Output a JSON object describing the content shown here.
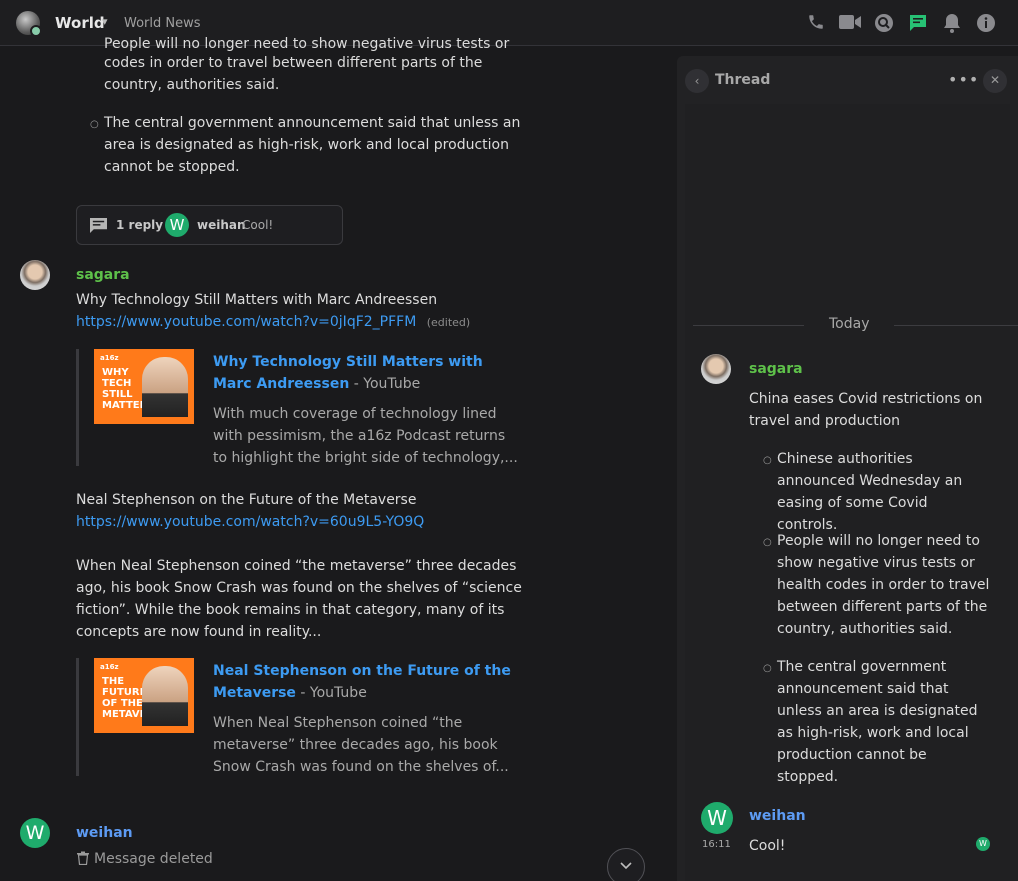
{
  "header": {
    "channel_name": "World",
    "topic": "World News"
  },
  "timeline": {
    "prev_message": {
      "partial_line": "People will no longer need to show negative virus tests or health",
      "bullet_2": "codes in order to travel between different parts of the country, authorities said.",
      "bullet_3": "The central government announcement said that unless an area is designated as high-risk, work and local production cannot be stopped."
    },
    "thread_summary": {
      "reply_count": "1 reply",
      "last_author": "weihan",
      "last_author_initial": "W",
      "last_text": "Cool!"
    },
    "sagara_message": {
      "author": "sagara",
      "line1": "Why Technology Still Matters with Marc Andreessen",
      "link1": "https://www.youtube.com/watch?v=0jIqF2_PFFM",
      "edited": "(edited)",
      "preview1": {
        "title": "Why Technology Still Matters with Marc Andreessen",
        "source": " - YouTube",
        "desc": "With much coverage of technology lined with pessimism, the a16z Podcast returns to highlight the bright side of technology,...",
        "thumb_logo": "a16z",
        "thumb_text": "WHY TECH STILL MATTERS"
      },
      "line2": "Neal Stephenson on the Future of the Metaverse",
      "link2": "https://www.youtube.com/watch?v=60u9L5-YO9Q",
      "para": "When Neal Stephenson coined “the metaverse” three decades ago, his book Snow Crash was found on the shelves of “science fiction”. While the book remains in that category, many of its concepts are now found in reality...",
      "preview2": {
        "title": "Neal Stephenson on the Future of the Metaverse",
        "source": " - YouTube",
        "desc": "When Neal Stephenson coined “the metaverse” three decades ago, his book Snow Crash was found on the shelves of...",
        "thumb_logo": "a16z",
        "thumb_text": "THE FUTURE OF THE METAVERSE"
      }
    },
    "weihan_message": {
      "author": "weihan",
      "initial": "W",
      "deleted_text": "Message deleted"
    }
  },
  "thread_panel": {
    "title": "Thread",
    "day_separator": "Today",
    "root": {
      "author": "sagara",
      "headline": "China eases Covid restrictions on travel and production",
      "bullets": [
        "Chinese authorities announced Wednesday an easing of some Covid controls.",
        "People will no longer need to show negative virus tests or health codes in order to travel between different parts of the country, authorities said.",
        "The central government announcement said that unless an area is designated as high-risk, work and local production cannot be stopped."
      ]
    },
    "reply": {
      "author": "weihan",
      "initial": "W",
      "time": "16:11",
      "text": "Cool!",
      "read_initial": "W"
    }
  },
  "colors": {
    "accent_green": "#27c174",
    "username_green": "#5ec14a",
    "username_blue": "#5d9bf3",
    "link": "#3d9bf2",
    "avatar_green": "#1fab6c"
  }
}
